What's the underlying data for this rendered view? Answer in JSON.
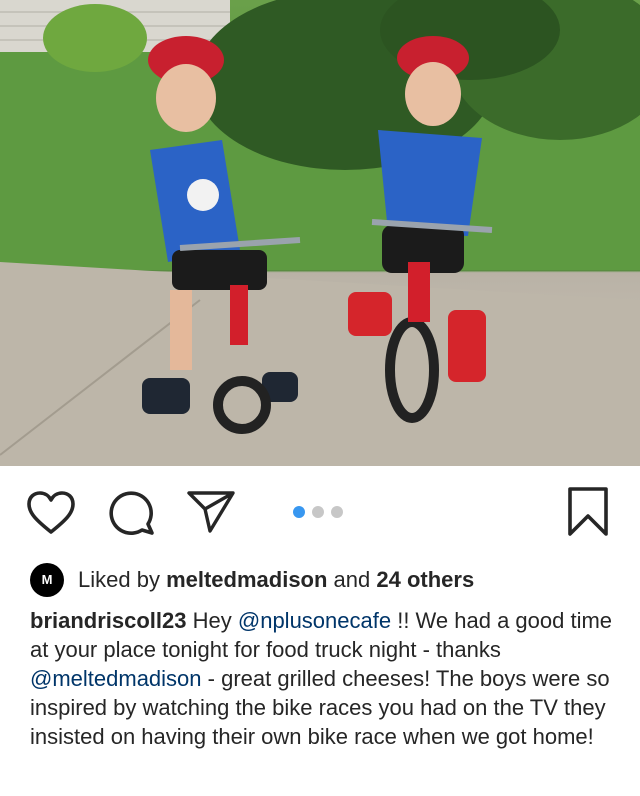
{
  "post": {
    "photo_alt": "",
    "carousel": {
      "count": 3,
      "active_index": 0
    },
    "icons": {
      "like": "heart-icon",
      "comment": "comment-icon",
      "share": "send-icon",
      "save": "bookmark-icon"
    },
    "colors": {
      "text": "#262626",
      "mention": "#003569",
      "active_dot": "#3897f0",
      "inactive_dot": "#c7c7c7"
    }
  },
  "likes": {
    "avatar_letter": "M",
    "prefix": "Liked by ",
    "user": "meltedmadison",
    "middle": " and ",
    "count": "24 others"
  },
  "caption": {
    "username": "briandriscoll23",
    "t1": " Hey ",
    "m1": "@nplusonecafe",
    "t2": " !! We had a good time at your place tonight for food truck night - thanks ",
    "m2": "@meltedmadison",
    "t3": " - great grilled cheeses! The boys were so inspired by watching the bike races you had on the TV they insisted on having their own bike race when we got home!"
  }
}
